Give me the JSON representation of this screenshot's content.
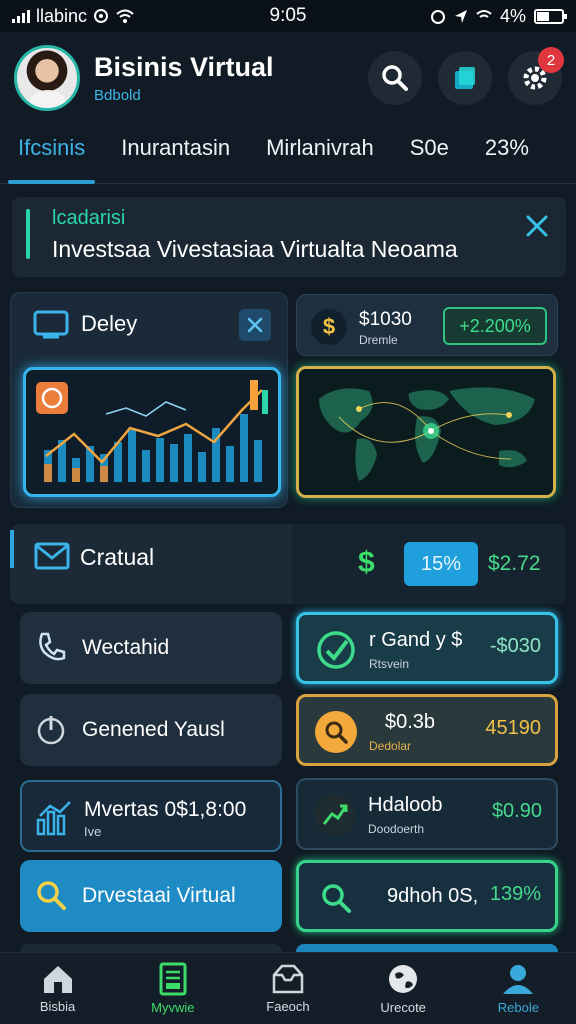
{
  "status_bar": {
    "carrier": "llabinc",
    "time": "9:05",
    "battery": "4%"
  },
  "header": {
    "title": "Bisinis Virtual",
    "subtitle": "Bdbold",
    "notification_count": "2"
  },
  "tabs": [
    {
      "label": "Ifcsinis",
      "active": true
    },
    {
      "label": "Inurantasin"
    },
    {
      "label": "Mirlanivrah"
    },
    {
      "label": "S0e"
    },
    {
      "label": "23%"
    }
  ],
  "banner": {
    "title": "lcadarisi",
    "text": "Investsaa Vivestasiaa Virtualta Neoama"
  },
  "deley_panel": {
    "label": "Deley"
  },
  "money_card": {
    "value": "$1030",
    "subtitle": "Dremle",
    "change": "+2.200%"
  },
  "crat_card": {
    "label": "Cratual",
    "percent": "15%",
    "value": "$2.72"
  },
  "left_rows": [
    {
      "label": "Wectahid",
      "icon": "phone-icon"
    },
    {
      "label": "Genened Yausl",
      "icon": "power-icon"
    },
    {
      "label": "Mvertas 0$1,8:00",
      "sub": "Ive",
      "icon": "bar-chart-icon"
    },
    {
      "label": "Drvestaai Virtual",
      "icon": "search-icon"
    }
  ],
  "right_rows": [
    {
      "title": "r Gand y $",
      "sub": "Rtsvein",
      "value": "-$030",
      "icon": "check-icon"
    },
    {
      "title": "$0.3b",
      "sub": "Dedolar",
      "value": "45190",
      "icon": "search-icon"
    },
    {
      "title": "Hdaloob",
      "sub": "Doodoerth",
      "value": "$0.90",
      "icon": "growth-icon"
    },
    {
      "title": "9dhoh 0S,",
      "sub": "",
      "value": "139%",
      "icon": "search-icon"
    }
  ],
  "bottom_nav": [
    {
      "label": "Bisbia",
      "icon": "home-icon"
    },
    {
      "label": "Myvwie",
      "icon": "document-icon",
      "active": true
    },
    {
      "label": "Faeoch",
      "icon": "inbox-icon"
    },
    {
      "label": "Urecote",
      "icon": "globe-icon"
    },
    {
      "label": "Rebole",
      "icon": "profile-icon"
    }
  ],
  "colors": {
    "accent_blue": "#2d9ed2",
    "accent_green": "#3ddc6a",
    "accent_gold": "#d8a23e",
    "background": "#101b25"
  }
}
